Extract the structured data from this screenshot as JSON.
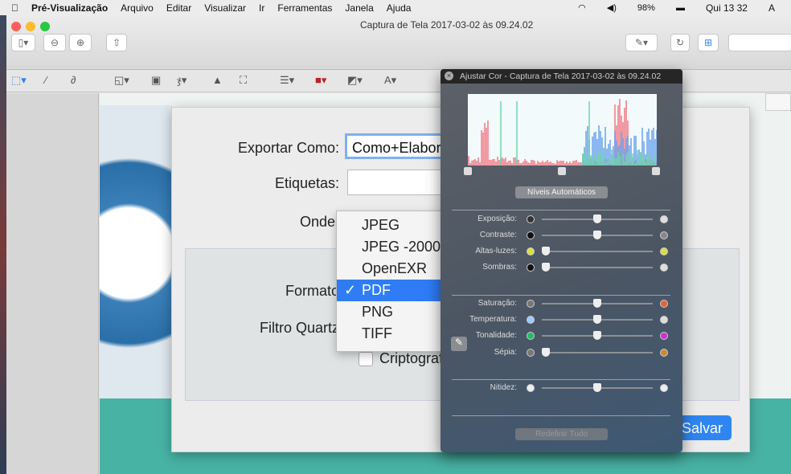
{
  "menubar": {
    "apple": "",
    "app": "Pré-Visualização",
    "items": [
      "Arquivo",
      "Editar",
      "Visualizar",
      "Ir",
      "Ferramentas",
      "Janela",
      "Ajuda"
    ],
    "battery": "98%",
    "clock": "Qui 13 32",
    "extra": "A"
  },
  "window": {
    "title": "Captura de Tela 2017-03-02 às 09.24.02"
  },
  "dialog": {
    "export_label": "Exportar Como:",
    "export_value": "Como+Elaborar",
    "tags_label": "Etiquetas:",
    "where_label": "Onde:",
    "format_label": "Formato",
    "quartz_label": "Filtro Quartz",
    "encrypt_label": "Criptografar",
    "save_label": "Salvar"
  },
  "format_menu": {
    "options": [
      "JPEG",
      "JPEG -2000",
      "OpenEXR",
      "PDF",
      "PNG",
      "TIFF"
    ],
    "selected": "PDF",
    "check": "✓"
  },
  "adjust": {
    "title": "Ajustar Cor - Captura de Tela 2017-03-02 às 09.24.02",
    "auto_levels": "Níveis Automáticos",
    "reset": "Redefinir Tudo",
    "sliders": [
      {
        "label": "Exposição:",
        "value": 0.5
      },
      {
        "label": "Contraste:",
        "value": 0.5
      },
      {
        "label": "Altas-luzes:",
        "value": 0
      },
      {
        "label": "Sombras:",
        "value": 0
      },
      {
        "label": "Saturação:",
        "value": 0.5
      },
      {
        "label": "Temperatura:",
        "value": 0.5
      },
      {
        "label": "Tonalidade:",
        "value": 0.5
      },
      {
        "label": "Sépia:",
        "value": 0
      },
      {
        "label": "Nitidez:",
        "value": 0.5
      }
    ],
    "levels": {
      "black": 0,
      "mid": 0.5,
      "white": 1
    }
  }
}
